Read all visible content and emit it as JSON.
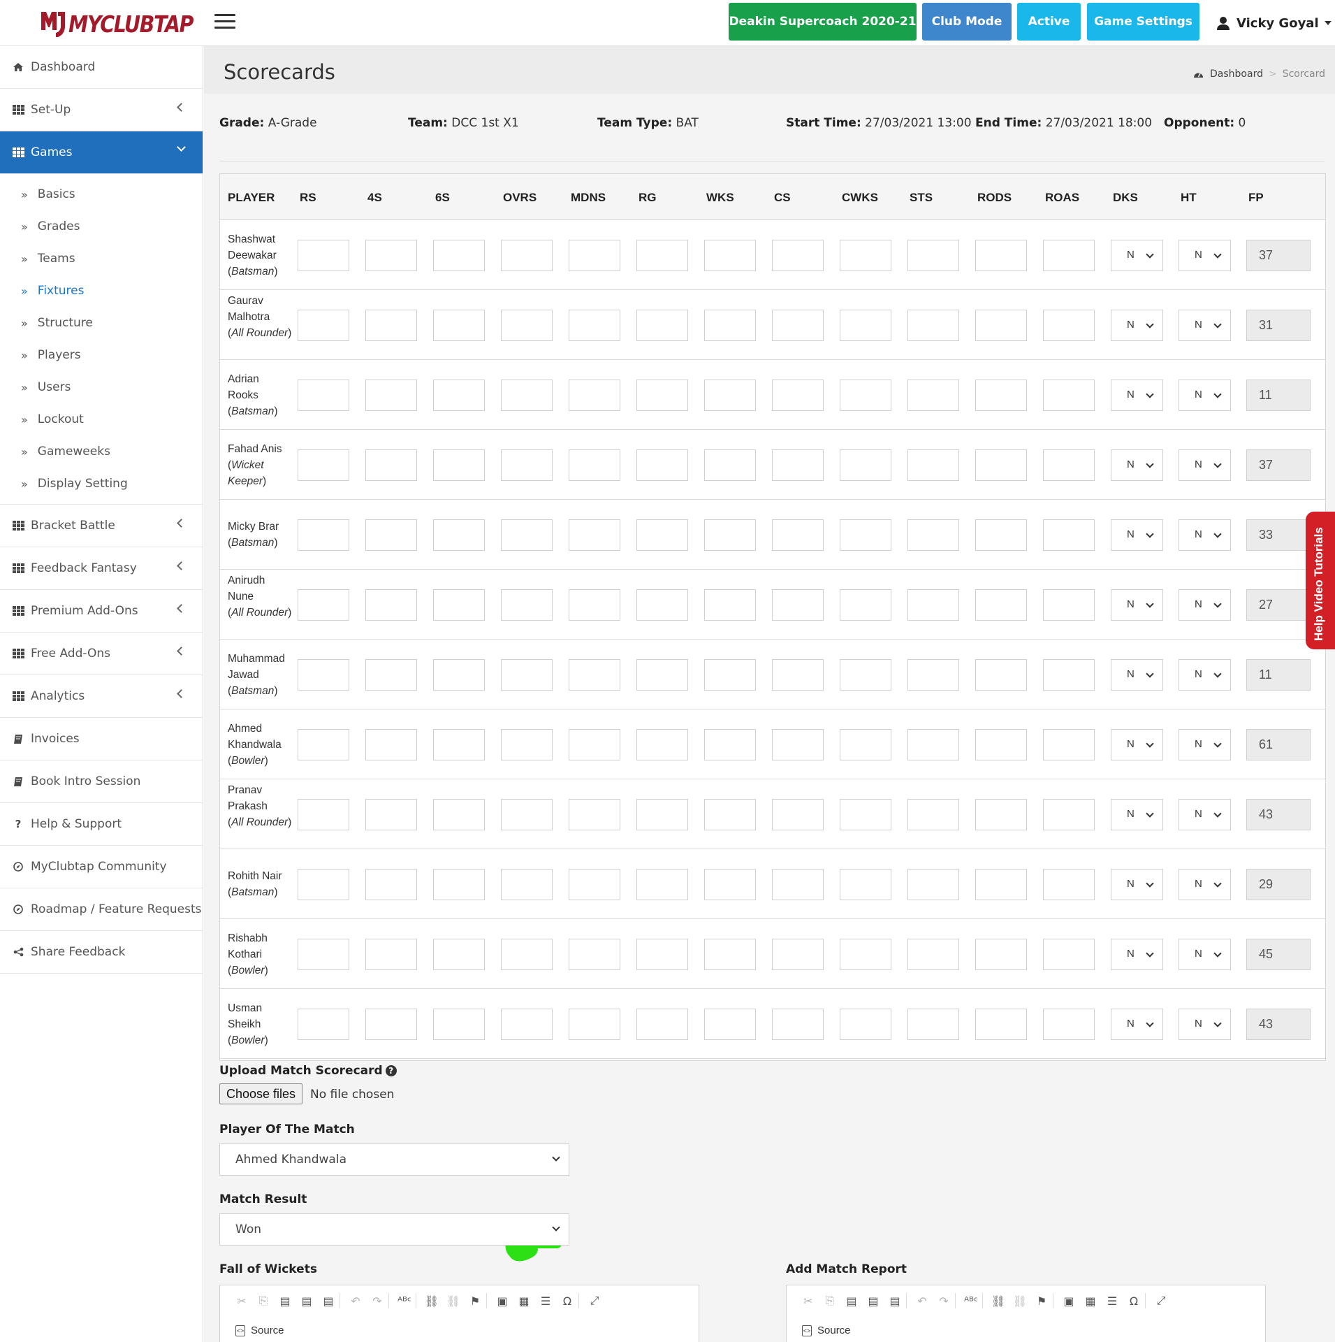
{
  "brand": {
    "name": "MYCLUBTAP",
    "color": "#a31a2a"
  },
  "header": {
    "season_btn": "Deakin Supercoach 2020-21",
    "club_mode_btn": "Club Mode",
    "active_btn": "Active",
    "game_settings_btn": "Game Settings",
    "user_name": "Vicky Goyal",
    "colors": {
      "season": "#19a04b",
      "club": "#3f87cd",
      "active": "#1ab8ea",
      "settings": "#1ab8ea"
    }
  },
  "sidebar": {
    "items": [
      {
        "label": "Dashboard",
        "icon": "home-icon"
      },
      {
        "label": "Set-Up",
        "icon": "grid-icon"
      },
      {
        "label": "Games",
        "icon": "grid-icon",
        "active": true
      },
      {
        "label": "Bracket Battle",
        "icon": "grid-icon"
      },
      {
        "label": "Feedback Fantasy",
        "icon": "grid-icon"
      },
      {
        "label": "Premium Add-Ons",
        "icon": "grid-icon"
      },
      {
        "label": "Free Add-Ons",
        "icon": "grid-icon"
      },
      {
        "label": "Analytics",
        "icon": "grid-icon"
      },
      {
        "label": "Invoices",
        "icon": "book-icon"
      },
      {
        "label": "Book Intro Session",
        "icon": "book-icon"
      },
      {
        "label": "Help & Support",
        "icon": "question-icon"
      },
      {
        "label": "MyClubtap Community",
        "icon": "compass-icon"
      },
      {
        "label": "Roadmap / Feature Requests",
        "icon": "compass-icon"
      },
      {
        "label": "Share Feedback",
        "icon": "share-icon"
      }
    ],
    "games_sub": [
      "Basics",
      "Grades",
      "Teams",
      "Fixtures",
      "Structure",
      "Players",
      "Users",
      "Lockout",
      "Gameweeks",
      "Display Setting"
    ],
    "games_sub_current": "Fixtures"
  },
  "page": {
    "title": "Scorecards",
    "breadcrumb": {
      "home": "Dashboard",
      "current": "Scorcard"
    }
  },
  "meta": {
    "grade_label": "Grade:",
    "grade": "A-Grade",
    "team_label": "Team:",
    "team": "DCC 1st X1",
    "team_type_label": "Team Type:",
    "team_type": "BAT",
    "start_label": "Start Time:",
    "start": "27/03/2021 13:00",
    "end_label": "End Time:",
    "end": "27/03/2021 18:00",
    "opponent_label": "Opponent:",
    "opponent": "0"
  },
  "scorecard": {
    "columns": [
      "PLAYER",
      "RS",
      "4S",
      "6S",
      "OVRS",
      "MDNS",
      "RG",
      "WKS",
      "CS",
      "CWKS",
      "STS",
      "RODS",
      "ROAS",
      "DKS",
      "HT",
      "FP"
    ],
    "select_value": "N",
    "rows": [
      {
        "name_lines": [
          "Shashwat",
          "Deewakar"
        ],
        "role": "Batsman",
        "fp": "37"
      },
      {
        "name_lines": [
          "Gaurav",
          "Malhotra"
        ],
        "role": "All Rounder",
        "fp": "31"
      },
      {
        "name_lines": [
          "Adrian",
          "Rooks"
        ],
        "role": "Batsman",
        "fp": "11"
      },
      {
        "name_lines": [
          "Fahad Anis"
        ],
        "role": "Wicket Keeper",
        "fp": "37"
      },
      {
        "name_lines": [
          "Micky Brar"
        ],
        "role": "Batsman",
        "fp": "33"
      },
      {
        "name_lines": [
          "Anirudh",
          "Nune"
        ],
        "role": "All Rounder",
        "fp": "27"
      },
      {
        "name_lines": [
          "Muhammad",
          "Jawad"
        ],
        "role": "Batsman",
        "fp": "11"
      },
      {
        "name_lines": [
          "Ahmed",
          "Khandwala"
        ],
        "role": "Bowler",
        "fp": "61"
      },
      {
        "name_lines": [
          "Pranav",
          "Prakash"
        ],
        "role": "All Rounder",
        "fp": "43"
      },
      {
        "name_lines": [
          "Rohith Nair"
        ],
        "role": "Batsman",
        "fp": "29"
      },
      {
        "name_lines": [
          "Rishabh",
          "Kothari"
        ],
        "role": "Bowler",
        "fp": "45"
      },
      {
        "name_lines": [
          "Usman",
          "Sheikh"
        ],
        "role": "Bowler",
        "fp": "43"
      }
    ]
  },
  "help_tab": "Help Video Tutorials",
  "upload": {
    "label": "Upload Match Scorecard",
    "button": "Choose files",
    "status": "No file chosen"
  },
  "potm": {
    "label": "Player Of The Match",
    "value": "Ahmed Khandwala"
  },
  "result": {
    "label": "Match Result",
    "value": "Won"
  },
  "fow": {
    "label": "Fall of Wickets",
    "source": "Source"
  },
  "report": {
    "label": "Add Match Report",
    "source": "Source"
  }
}
